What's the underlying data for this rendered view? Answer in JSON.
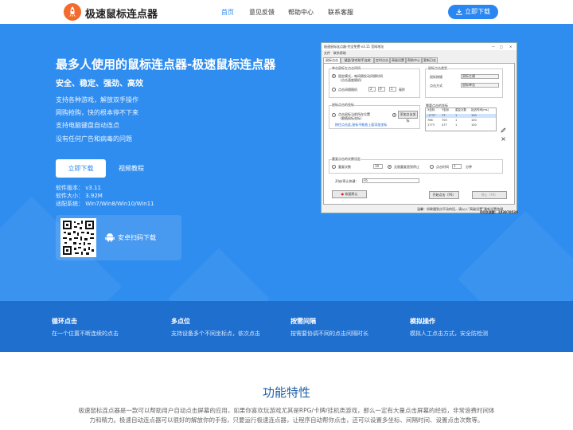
{
  "header": {
    "brand": "极速鼠标连点器",
    "nav": [
      "首页",
      "意见反馈",
      "帮助中心",
      "联系客服"
    ],
    "download_label": "立即下载"
  },
  "hero": {
    "title": "最多人使用的鼠标连点器-极速鼠标连点器",
    "subtitle": "安全、稳定、强劲、高效",
    "features": [
      "支持各种游戏，解放双手操作",
      "网购抢购，快的根本停不下来",
      "支持电脑键盘自动连点",
      "没有任何广告和病毒的问题"
    ],
    "download_button": "立即下载",
    "video_button": "视频教程",
    "info": [
      "软件版本：   v3.11",
      "软件大小：   3.92M",
      "适配系统：   Win7/Win8/Win10/Win11"
    ],
    "qr_label": "安卓扫码下载"
  },
  "app_window": {
    "title": "极速鼠标连点器-完全免费·v3.11   官网地址",
    "controls": [
      "—",
      "□",
      "×"
    ],
    "menu": [
      "文件",
      "联系帮助"
    ],
    "tabs": [
      "鼠标点击",
      "键盘/游戏助手连按",
      "定时点击",
      "高级设置",
      "帮助中心",
      "更新日志"
    ],
    "group_click": "单击鼠标左点击间间",
    "radio_fixed": "固定模式，每间隔发动间隔时间",
    "radio_fixed_sub": "（点击速度随机）",
    "radio_random": "点击间隔随机",
    "random_vals": [
      "2",
      "0",
      "1",
      "毫秒"
    ],
    "group_type": "鼠标点击类型",
    "type_row1_label": "鼠标按键",
    "type_row1_value": "鼠标左键",
    "type_row2_label": "点击方式",
    "type_row2_value": "鼠标单击",
    "group_pos": "鼠标点击的坐标",
    "radio_mouse_pos": "点击鼠标当前所在位置",
    "radio_mouse_pos_sub": "（跟随鼠标坐标）",
    "pos_button": "添加点击坐标",
    "pos_hint": "按住点击此,鼠标不能放上面添加坐标",
    "table_title": "需要点击的坐标",
    "table_headers": [
      "X坐标",
      "Y坐标",
      "重复次数",
      "延迟时间(ms)"
    ],
    "table_rows": [
      [
        "-1737",
        "73",
        "1",
        "100"
      ],
      [
        "766",
        "705",
        "1",
        "100"
      ],
      [
        "1773",
        "477",
        "1",
        "100"
      ]
    ],
    "group_stop": "重复点击的次数设定",
    "stop_count_label": "重复次数",
    "stop_count_value": "10",
    "stop_infinite": "无限重复直到停止",
    "stop_time_label": "点击时间",
    "stop_time_value": "1",
    "stop_time_unit": "分钟",
    "hotkey_label": "开始/停止热键：",
    "hotkey_value": "F6",
    "bottom_left": "恢复默认",
    "start_btn": "开始点击（F6）",
    "stop_btn": "停止（F6）",
    "status": "温馨：如果遇到点不动的话，请以入“高级设置”重新设置热键",
    "qq": "QQ交流群：183970530"
  },
  "feature_bar": [
    {
      "title": "循环点击",
      "desc": "在一个位置不断连续的点击"
    },
    {
      "title": "多点位",
      "desc": "支持设备多个不同坐标点，依次点击"
    },
    {
      "title": "按需间隔",
      "desc": "按需要协调不同的点击间隔时长"
    },
    {
      "title": "模拟操作",
      "desc": "模拟人工点击方式，安全防检测"
    }
  ],
  "section": {
    "title": "功能特性",
    "line1": "极速鼠标连点器是一款可以帮助用户自动点击屏幕的应用，如果你喜欢玩游戏尤其是RPG/卡牌/挂机类游戏，那么一定有大量点击屏幕的经验，非常浪费时间体",
    "line2": "力和精力。极速自动连点器可以很好的解放你的手指，只要运行极速连点器，让程序自动帮你点击，还可以设置多坐标、间隔时间、设置点击次数等。"
  },
  "colors": {
    "primary": "#2f8df0",
    "primary_dark": "#1f6fcf",
    "brand_orange": "#f36b2e"
  },
  "icons": [
    "rocket-logo-icon",
    "download-icon",
    "android-icon",
    "qr-code-icon"
  ]
}
